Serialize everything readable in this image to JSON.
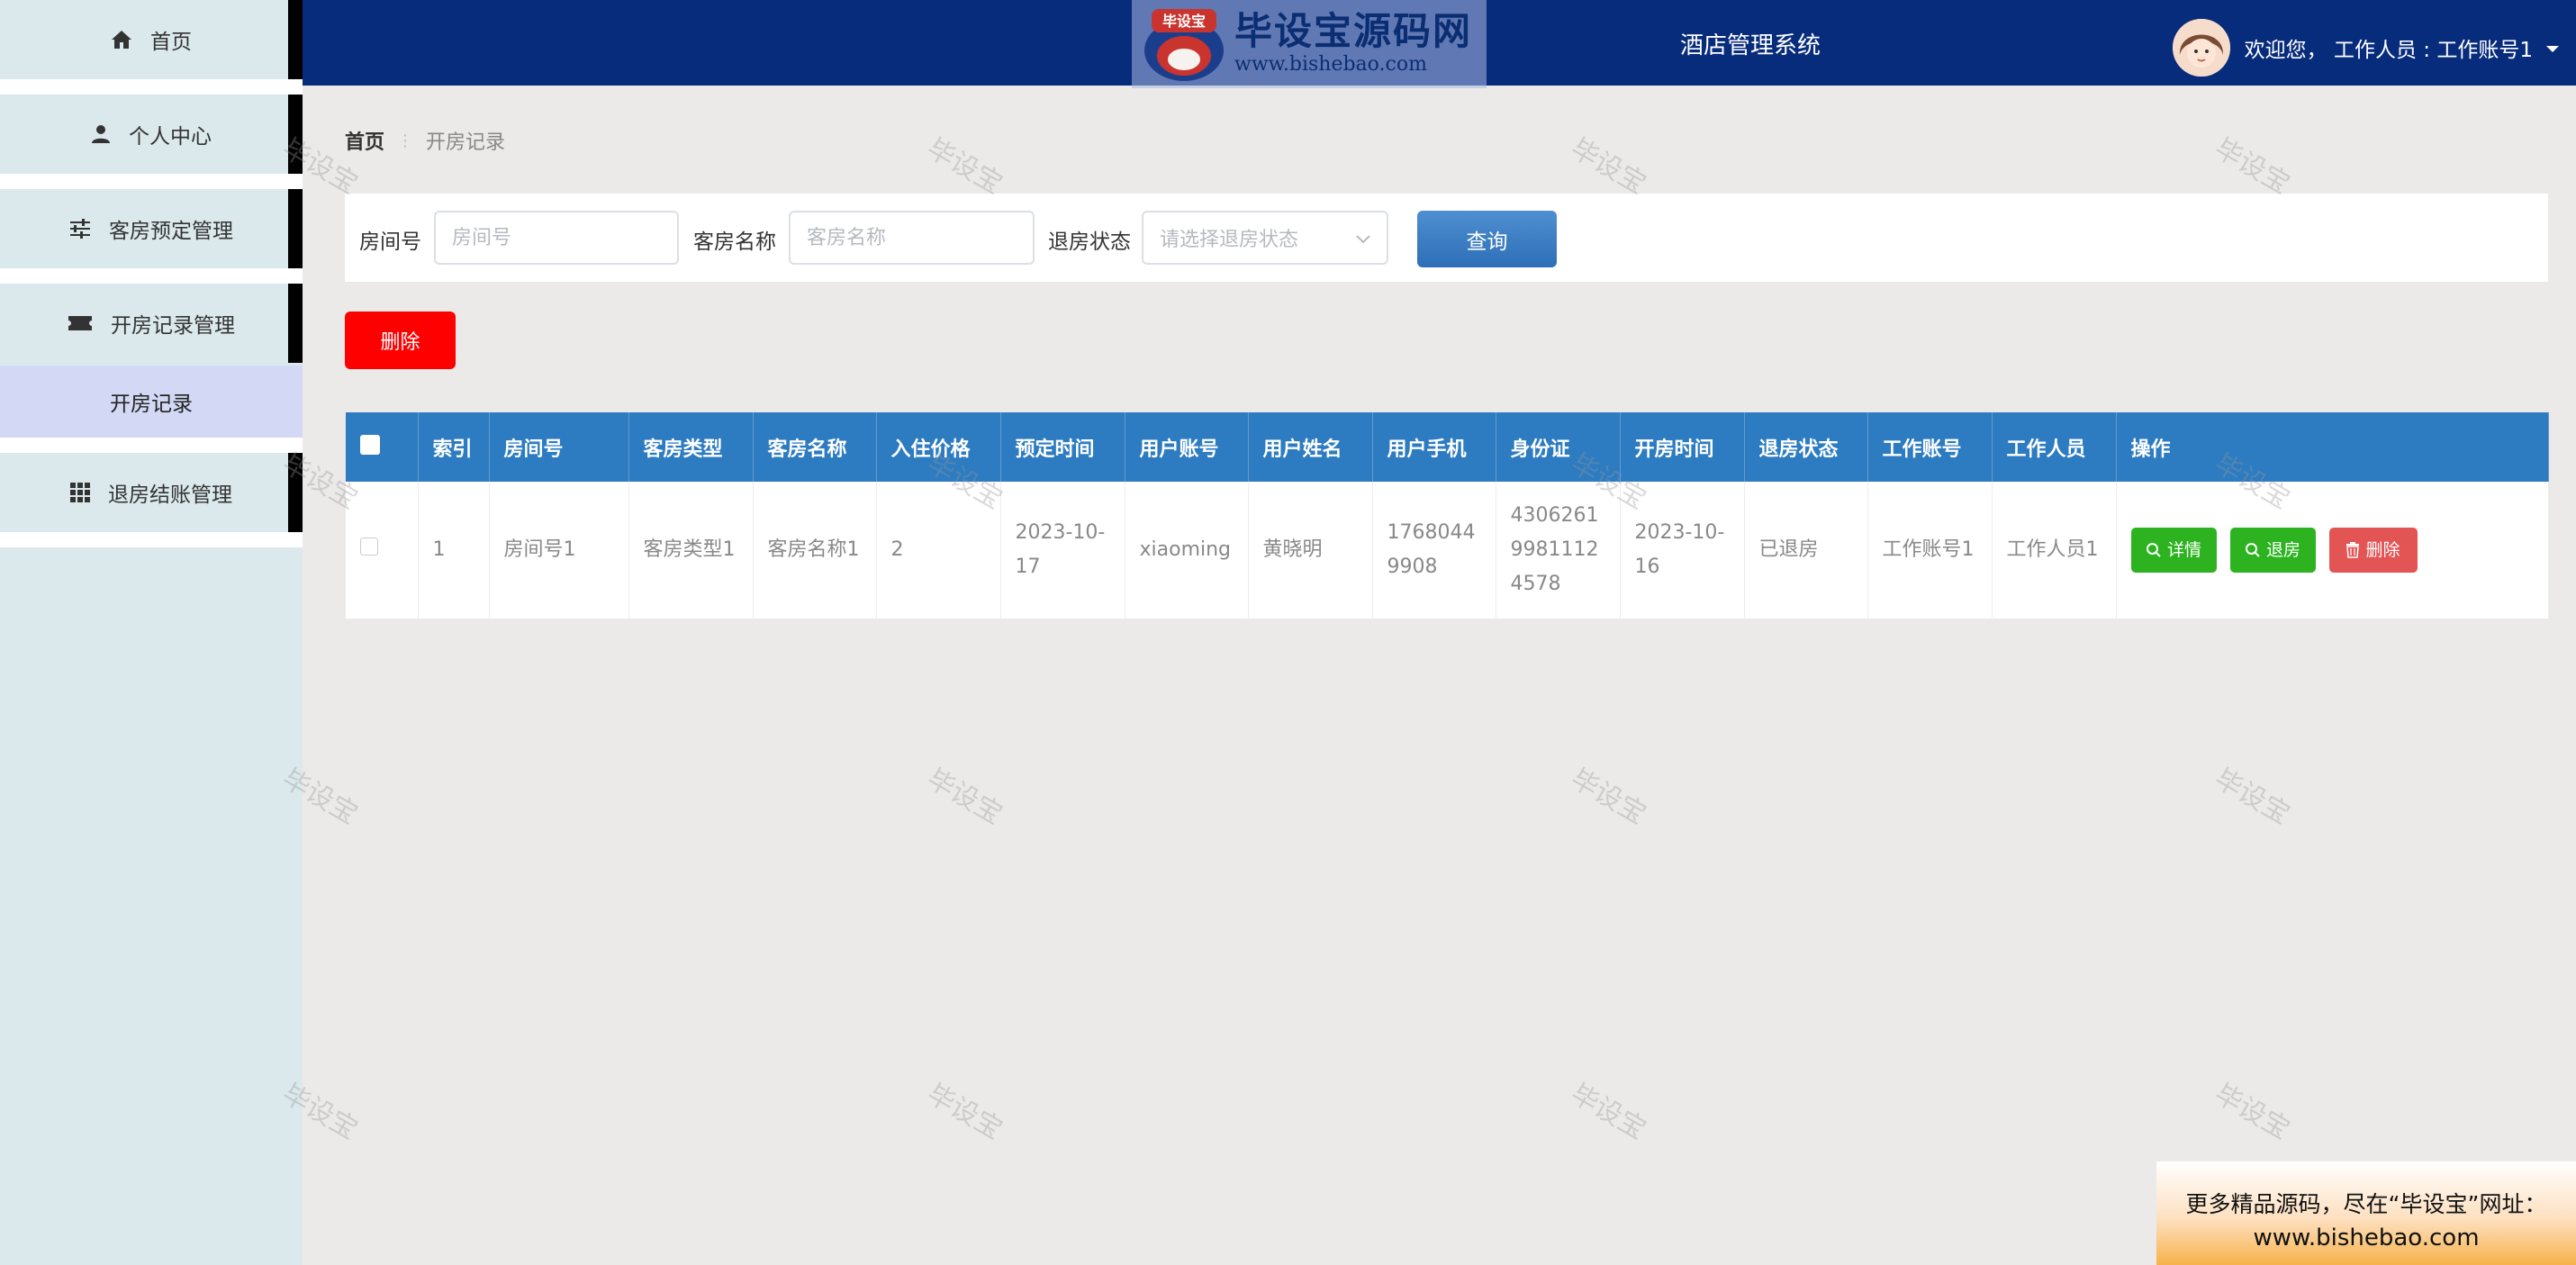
{
  "sidebar": {
    "items": [
      {
        "label": "首页",
        "icon": "home-icon"
      },
      {
        "label": "个人中心",
        "icon": "user-icon"
      },
      {
        "label": "客房预定管理",
        "icon": "sliders-icon"
      },
      {
        "label": "开房记录管理",
        "icon": "ticket-icon"
      },
      {
        "label": "退房结账管理",
        "icon": "grid-icon"
      }
    ],
    "sub_item": "开房记录"
  },
  "header": {
    "title": "酒店管理系统",
    "logo_text": "毕设宝源码网",
    "logo_badge": "毕设宝",
    "logo_url": "www.bishebao.com",
    "welcome": "欢迎您， 工作人员 : 工作账号1"
  },
  "breadcrumb": {
    "home": "首页",
    "current": "开房记录"
  },
  "search": {
    "room_no_label": "房间号",
    "room_no_placeholder": "房间号",
    "room_name_label": "客房名称",
    "room_name_placeholder": "客房名称",
    "status_label": "退房状态",
    "status_placeholder": "请选择退房状态",
    "query_button": "查询"
  },
  "actions": {
    "delete_button": "删除"
  },
  "table": {
    "columns": [
      "索引",
      "房间号",
      "客房类型",
      "客房名称",
      "入住价格",
      "预定时间",
      "用户账号",
      "用户姓名",
      "用户手机",
      "身份证",
      "开房时间",
      "退房状态",
      "工作账号",
      "工作人员",
      "操作"
    ],
    "rows": [
      {
        "index": "1",
        "room_no": "房间号1",
        "room_type": "客房类型1",
        "room_name": "客房名称1",
        "price": "2",
        "book_time": "2023-10-17",
        "user_account": "xiaoming",
        "user_name": "黄晓明",
        "user_phone": "17680449908",
        "id_card": "430626199811124578",
        "open_time": "2023-10-16",
        "checkout_status": "已退房",
        "staff_account": "工作账号1",
        "staff_name": "工作人员1",
        "ops": {
          "detail": "详情",
          "checkout": "退房",
          "delete": "删除"
        }
      }
    ]
  },
  "watermark": "毕设宝",
  "ad": {
    "line1": "更多精品源码，尽在“毕设宝”网址：",
    "line2": "www.bishebao.com"
  },
  "colors": {
    "header": "#082c7c",
    "sidebar": "#dbe9ec",
    "table_head": "#2d7cc1",
    "delete": "#ff0000",
    "green": "#2cb31f",
    "red_btn": "#e35454"
  }
}
